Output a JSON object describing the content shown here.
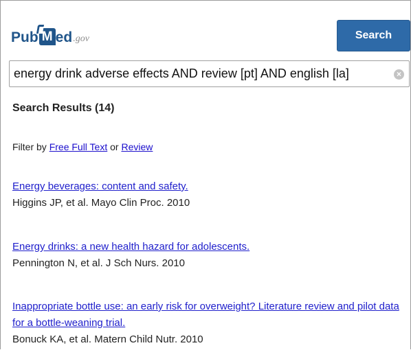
{
  "header": {
    "logo": {
      "pub": "Pub",
      "m": "M",
      "ed": "ed",
      "gov": ".gov"
    },
    "search_button_label": "Search"
  },
  "search": {
    "query": "energy drink adverse effects AND review [pt] AND english [la]",
    "clear_icon": "clear-circle-x-icon"
  },
  "results": {
    "heading": "Search Results (14)",
    "filter": {
      "prefix": "Filter by ",
      "free_full_text": "Free Full Text",
      "or": " or ",
      "review": "Review"
    },
    "items": [
      {
        "title": "Energy beverages: content and safety.",
        "citation": "Higgins JP, et al. Mayo Clin Proc. 2010"
      },
      {
        "title": "Energy drinks: a new health hazard for adolescents.",
        "citation": "Pennington N, et al. J Sch Nurs. 2010"
      },
      {
        "title": "Inappropriate bottle use: an early risk for overweight? Literature review and pilot data for a bottle-weaning trial.",
        "citation": "Bonuck KA, et al. Matern Child Nutr. 2010"
      }
    ]
  },
  "colors": {
    "brand": "#20558a",
    "button": "#2e6aa8",
    "link": "#1a0dcc"
  }
}
